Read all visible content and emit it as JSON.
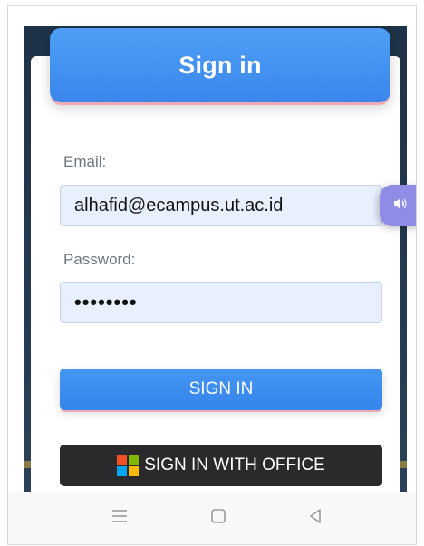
{
  "header": {
    "title": "Sign in"
  },
  "form": {
    "email_label": "Email:",
    "email_value": "alhafid@ecampus.ut.ac.id",
    "password_label": "Password:",
    "password_value": "••••••••",
    "sign_in_label": "SIGN IN",
    "office_label": "SIGN IN WITH OFFICE"
  },
  "icons": {
    "accessibility": "speaker-icon",
    "microsoft": "microsoft-logo-icon",
    "nav_menu": "menu-icon",
    "nav_home": "home-square-icon",
    "nav_back": "back-triangle-icon"
  },
  "colors": {
    "primary": "#3a86ec",
    "office_button": "#2a2a2c",
    "field_bg": "#e8f0fe",
    "accessibility_fab": "#8f8ce6",
    "ms_red": "#f25022",
    "ms_green": "#7fba00",
    "ms_blue": "#00a4ef",
    "ms_yellow": "#ffb900"
  }
}
